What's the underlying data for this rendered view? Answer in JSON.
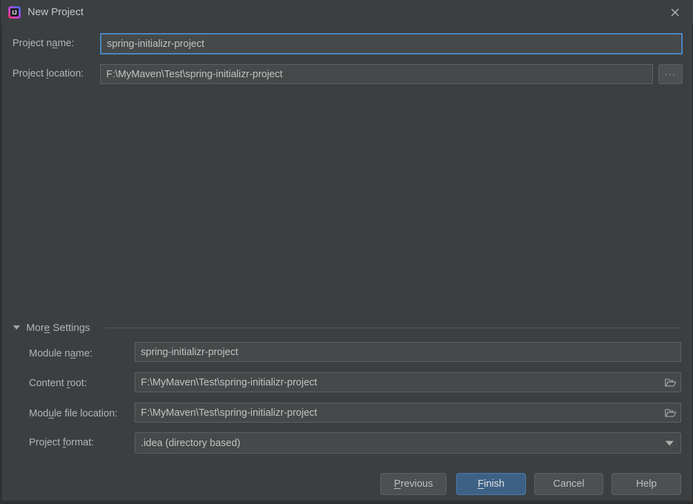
{
  "window": {
    "title": "New Project",
    "app_icon": "intellij-idea-icon",
    "close_icon": "close-icon",
    "accent_color": "#4a88c7",
    "primary_button_color": "#3d6185",
    "background_color": "#3c3f41",
    "field_background_color": "#45494a"
  },
  "form": {
    "project_name": {
      "label_before": "Project n",
      "label_mnemonic": "a",
      "label_after": "me:",
      "value": "spring-initializr-project",
      "placeholder": "",
      "focused": true
    },
    "project_location": {
      "label_before": "Project ",
      "label_mnemonic": "l",
      "label_after": "ocation:",
      "value": "F:\\MyMaven\\Test\\spring-initializr-project",
      "placeholder": "",
      "browse_label": "...",
      "browse_icon": "ellipsis-icon"
    }
  },
  "more_settings": {
    "label_before": "Mor",
    "label_mnemonic": "e",
    "label_after": " Settings",
    "expanded": true,
    "expand_icon": "chevron-down-icon",
    "fields": {
      "module_name": {
        "label_before": "Module n",
        "label_mnemonic": "a",
        "label_after": "me:",
        "value": "spring-initializr-project",
        "icon": ""
      },
      "content_root": {
        "label_before": "Content ",
        "label_mnemonic": "r",
        "label_after": "oot:",
        "value": "F:\\MyMaven\\Test\\spring-initializr-project",
        "icon": "folder-icon"
      },
      "module_file_location": {
        "label_before": "Mod",
        "label_mnemonic": "u",
        "label_after": "le file location:",
        "value": "F:\\MyMaven\\Test\\spring-initializr-project",
        "icon": "folder-icon"
      },
      "project_format": {
        "label_before": "Project ",
        "label_mnemonic": "f",
        "label_after": "ormat:",
        "value": ".idea (directory based)",
        "icon": "chevron-down-icon",
        "options": [
          ".idea (directory based)"
        ]
      }
    }
  },
  "buttons": {
    "previous": {
      "before": "",
      "mnemonic": "P",
      "after": "revious"
    },
    "finish": {
      "before": "",
      "mnemonic": "F",
      "after": "inish"
    },
    "cancel": {
      "before": "Cancel",
      "mnemonic": "",
      "after": ""
    },
    "help": {
      "before": "Help",
      "mnemonic": "",
      "after": ""
    }
  }
}
